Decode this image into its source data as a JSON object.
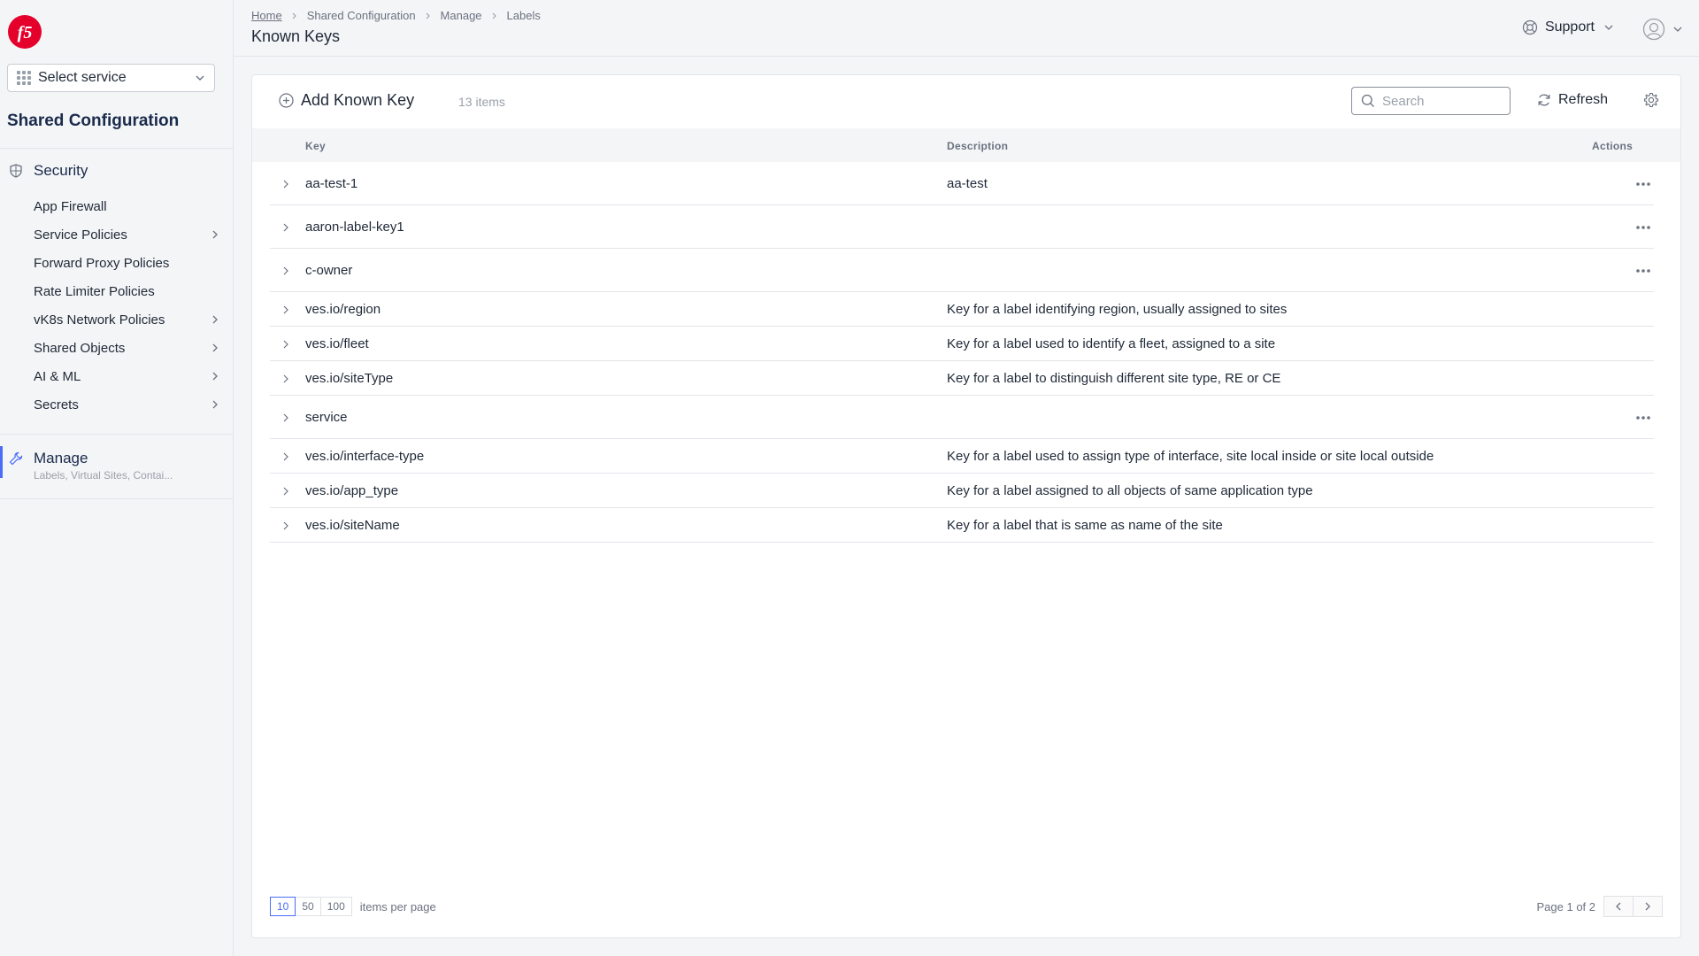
{
  "sidebar": {
    "service_select": "Select service",
    "workspace_title": "Shared Configuration",
    "section": {
      "label": "Security",
      "icon": "shield-icon"
    },
    "items": [
      {
        "label": "App Firewall",
        "has_children": false
      },
      {
        "label": "Service Policies",
        "has_children": true
      },
      {
        "label": "Forward Proxy Policies",
        "has_children": false
      },
      {
        "label": "Rate Limiter Policies",
        "has_children": false
      },
      {
        "label": "vK8s Network Policies",
        "has_children": true
      },
      {
        "label": "Shared Objects",
        "has_children": true
      },
      {
        "label": "AI & ML",
        "has_children": true
      },
      {
        "label": "Secrets",
        "has_children": true
      }
    ],
    "manage": {
      "label": "Manage",
      "sub": "Labels, Virtual Sites, Contai..."
    }
  },
  "header": {
    "breadcrumb": [
      "Home",
      "Shared Configuration",
      "Manage",
      "Labels"
    ],
    "title": "Known Keys",
    "support": "Support"
  },
  "toolbar": {
    "add_label": "Add Known Key",
    "count": "13 items",
    "search_placeholder": "Search",
    "refresh_label": "Refresh"
  },
  "table": {
    "columns": {
      "key": "Key",
      "description": "Description",
      "actions": "Actions"
    },
    "rows": [
      {
        "key": "aa-test-1",
        "description": "aa-test",
        "actions": true
      },
      {
        "key": "aaron-label-key1",
        "description": "",
        "actions": true
      },
      {
        "key": "c-owner",
        "description": "",
        "actions": true
      },
      {
        "key": "ves.io/region",
        "description": "Key for a label identifying region, usually assigned to sites",
        "actions": false
      },
      {
        "key": "ves.io/fleet",
        "description": "Key for a label used to identify a fleet, assigned to a site",
        "actions": false
      },
      {
        "key": "ves.io/siteType",
        "description": "Key for a label to distinguish different site type, RE or CE",
        "actions": false
      },
      {
        "key": "service",
        "description": "",
        "actions": true
      },
      {
        "key": "ves.io/interface-type",
        "description": "Key for a label used to assign type of interface, site local inside or site local outside",
        "actions": false
      },
      {
        "key": "ves.io/app_type",
        "description": "Key for a label assigned to all objects of same application type",
        "actions": false
      },
      {
        "key": "ves.io/siteName",
        "description": "Key for a label that is same as name of the site",
        "actions": false
      }
    ]
  },
  "pagination": {
    "sizes": [
      "10",
      "50",
      "100"
    ],
    "active_size": "10",
    "per_page_label": "items per page",
    "page_info": "Page 1 of 2"
  },
  "colors": {
    "accent": "#4a6cf7",
    "brand": "#e4002b"
  }
}
